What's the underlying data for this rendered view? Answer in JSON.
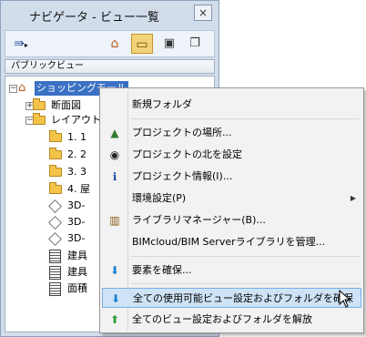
{
  "window": {
    "title": "ナビゲータ - ビュー一覧",
    "close_label": "×",
    "dropdown_value": "パブリックビュー"
  },
  "toolbar": {
    "buttons": [
      {
        "name": "publish-icon",
        "glyph": "⇛"
      },
      {
        "name": "project-map-icon",
        "glyph": "⌂"
      },
      {
        "name": "view-map-icon",
        "glyph": "▭"
      },
      {
        "name": "layout-book-icon",
        "glyph": "▣"
      },
      {
        "name": "publisher-sets-icon",
        "glyph": "❐"
      }
    ]
  },
  "tree": {
    "root": "ショッピングモール",
    "items": [
      {
        "label": "断面図"
      },
      {
        "label": "レイアウト"
      },
      {
        "label": "1. 1"
      },
      {
        "label": "2. 2"
      },
      {
        "label": "3. 3"
      },
      {
        "label": "4. 屋"
      },
      {
        "label": "3D-"
      },
      {
        "label": "3D-"
      },
      {
        "label": "3D-"
      },
      {
        "label": "建具"
      },
      {
        "label": "建具"
      },
      {
        "label": "面積"
      }
    ]
  },
  "menu": {
    "items": [
      {
        "label": "新規フォルダ"
      },
      {
        "label": "プロジェクトの場所..."
      },
      {
        "label": "プロジェクトの北を設定"
      },
      {
        "label": "プロジェクト情報(I)..."
      },
      {
        "label": "環境設定(P)"
      },
      {
        "label": "ライブラリマネージャー(B)..."
      },
      {
        "label": "BIMcloud/BIM Serverライブラリを管理..."
      },
      {
        "label": "要素を確保..."
      },
      {
        "label": "全ての使用可能ビュー設定およびフォルダを確保"
      },
      {
        "label": "全てのビュー設定およびフォルダを解放"
      }
    ]
  }
}
